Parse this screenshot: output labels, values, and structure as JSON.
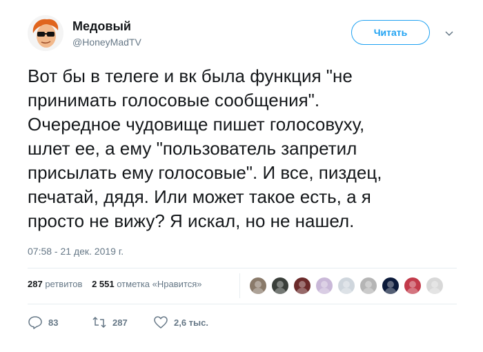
{
  "author": {
    "display_name": "Медовый",
    "handle": "@HoneyMadTV"
  },
  "follow_button": {
    "label": "Читать"
  },
  "tweet": {
    "lines": [
      "Вот бы в телеге и вк была функция \"не",
      "принимать голосовые сообщения\".",
      "Очередное чудовище пишет голосовуху,",
      "шлет ее, а ему \"пользователь запретил",
      "присылать ему голосовые\". И все, пиздец,",
      "печатай, дядя. Или может такое есть, а я",
      "просто не вижу? Я искал, но не нашел."
    ],
    "timestamp": "07:58 - 21 дек. 2019 г."
  },
  "stats": {
    "retweets_count": "287",
    "retweets_label": "ретвитов",
    "likes_count": "2 551",
    "likes_label": "отметка «Нравится»"
  },
  "likers": [
    {
      "icon": "liker-avatar",
      "color": "#8a7a6a"
    },
    {
      "icon": "liker-avatar",
      "color": "#3a3f3a"
    },
    {
      "icon": "liker-avatar",
      "color": "#6b2a2a"
    },
    {
      "icon": "liker-avatar",
      "color": "#c9b8d8"
    },
    {
      "icon": "liker-avatar",
      "color": "#cfd6dd"
    },
    {
      "icon": "liker-avatar",
      "color": "#b5b5b5"
    },
    {
      "icon": "liker-avatar",
      "color": "#0b1a3a"
    },
    {
      "icon": "liker-avatar",
      "color": "#c23a4a"
    },
    {
      "icon": "liker-avatar",
      "color": "#d8d8d8"
    }
  ],
  "actions": {
    "reply_count": "83",
    "retweet_count": "287",
    "like_count": "2,6 тыс."
  },
  "colors": {
    "accent": "#1da1f2",
    "muted": "#657786",
    "text": "#14171a",
    "divider": "#e6ecf0"
  }
}
